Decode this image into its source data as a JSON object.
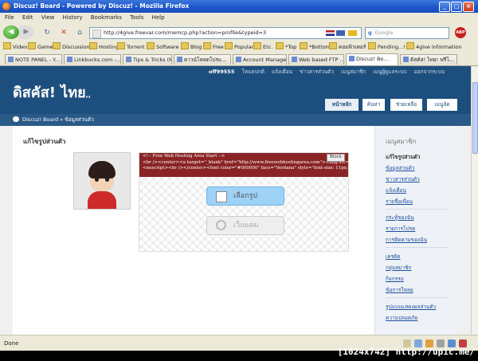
{
  "window": {
    "title": "Discuz! Board - Powered by Discuz! - Mozilla Firefox"
  },
  "menubar": [
    "File",
    "Edit",
    "View",
    "History",
    "Bookmarks",
    "Tools",
    "Help"
  ],
  "navbar": {
    "url": "http://4give.freevar.com/memcp.php?action=profile&typeid=3",
    "search_placeholder": "Google",
    "abp_label": "ABP"
  },
  "bookmarks": [
    "Video",
    "Game",
    "Discussion",
    "Hosting",
    "Torrent",
    "Software",
    "Blog",
    "Free",
    "Popular",
    "Etc.",
    "*Top",
    "*Bottom",
    "คอมพิวเตอร์",
    "Pending...!",
    "4give information"
  ],
  "tabs": [
    {
      "label": "NOTE PANEL - Y...",
      "active": false
    },
    {
      "label": "Linkbucks.com -...",
      "active": false
    },
    {
      "label": "Tips & Tricks (Ma...",
      "active": false
    },
    {
      "label": "ดาวน์โหลดโปรแ...",
      "active": false
    },
    {
      "label": "Account Manager",
      "active": false
    },
    {
      "label": "Web based FTP ...",
      "active": false
    },
    {
      "label": "Discuz! Bo...",
      "active": true
    },
    {
      "label": "ดิสคัส! ไทย! ฟรีโ...",
      "active": false
    }
  ],
  "site": {
    "top_links": {
      "user": "off99555",
      "items": [
        "โหมดปกติ",
        "แจ้งเตือน",
        "ข่าวสารส่วนตัว",
        "เมนูสมาชิก",
        "เมนูผู้ดูแลระบบ",
        "ออกจากระบบ"
      ]
    },
    "logo_text": "ดิสคัส! ไทย",
    "logo_suffix": ",,",
    "nav_tabs": [
      "หน้าหลัก",
      "ค้นหา",
      "ช่วยเหลือ",
      "เมนูลัด"
    ],
    "breadcrumb": "Discuz! Board » ข้อมูลส่วนตัว",
    "page_title": "แก้ไขรูปส่วนตัว",
    "ad_lines": [
      "<!-- Free Web Hosting Area Start -->",
      "<br /><center><a target=\"_blank\" href=\"http://www.freewebhostingarea.com\"><img src=",
      "<noscript><br /></center><font color=\"#000000\" face=\"Verdana\" style=\"font-size: 11px; bac"
    ],
    "ad_block_label": "Block",
    "select_button": "เลือกรูป",
    "webcam_button": "เว็บแคม",
    "sidebar": {
      "title": "เมนูสมาชิก",
      "current": "แก้ไขรูปส่วนตัว",
      "groups": [
        [
          "ข้อมูลส่วนตัว",
          "ข่าวสารส่วนตัว",
          "แจ้งเตือน",
          "รายชื่อเพื่อน"
        ],
        [
          "กระทู้ของฉัน",
          "รายการโปรด",
          "การติดตามของฉัน"
        ],
        [
          "เครดิต",
          "กลุ่มสมาชิก",
          "กิจกรรม",
          "ข้อการใหลย"
        ],
        [
          "รูปแบบแสดงผลส่วนตัว",
          "ความปลอดภัย"
        ]
      ]
    }
  },
  "status": {
    "text": "Done"
  },
  "watermark": "[1024x742] http://upic.me/"
}
